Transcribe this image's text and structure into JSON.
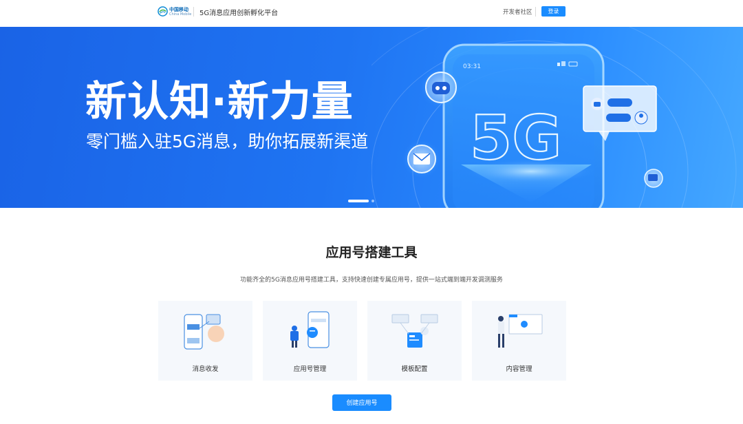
{
  "header": {
    "logo_cn": "中国移动",
    "logo_en": "China Mobile",
    "site_title": "5G消息应用创新孵化平台",
    "developer_community": "开发者社区",
    "login_label": "登录"
  },
  "banner": {
    "headline": "新认知·新力量",
    "subheadline": "零门槛入驻5G消息，助你拓展新渠道",
    "phone_time": "03:31",
    "phone_badge": "5G"
  },
  "tools": {
    "title": "应用号搭建工具",
    "subtitle": "功能齐全的5G消息应用号搭建工具，支持快速创建专属应用号，提供一站式端到端开发调测服务",
    "cards": [
      {
        "label": "消息收发",
        "icon": "message-exchange-icon"
      },
      {
        "label": "应用号管理",
        "icon": "app-account-management-icon"
      },
      {
        "label": "模板配置",
        "icon": "template-config-icon"
      },
      {
        "label": "内容管理",
        "icon": "content-management-icon"
      }
    ],
    "create_button_label": "创建应用号"
  },
  "colors": {
    "primary": "#1a8cff",
    "banner_start": "#1a63e6",
    "banner_end": "#45a8ff",
    "card_bg": "#f5f8fc"
  }
}
